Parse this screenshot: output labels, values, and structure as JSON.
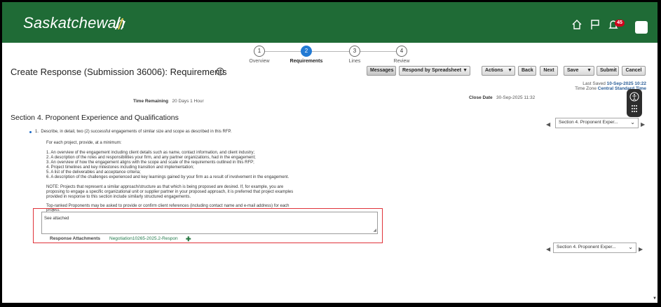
{
  "header": {
    "logo_text": "Saskatchewan",
    "notification_count": "45",
    "icons": [
      "home-icon",
      "flag-icon",
      "bell-icon",
      "user-avatar"
    ],
    "background": "#1f6b36"
  },
  "train": {
    "steps": [
      {
        "number": "1",
        "label": "Overview",
        "active": false
      },
      {
        "number": "2",
        "label": "Requirements",
        "active": true
      },
      {
        "number": "3",
        "label": "Lines",
        "active": false
      },
      {
        "number": "4",
        "label": "Review",
        "active": false
      }
    ]
  },
  "page": {
    "title": "Create Response (Submission 36006): Requirements"
  },
  "toolbar": {
    "messages": "Messages",
    "respond_by_spreadsheet": "Respond by Spreadsheet",
    "actions": "Actions",
    "back": "Back",
    "next": "Next",
    "save": "Save",
    "submit": "Submit",
    "cancel": "Cancel"
  },
  "status": {
    "last_saved_label": "Last Saved",
    "last_saved_value": "10-Sep-2025 10:22",
    "time_zone_label": "Time Zone",
    "time_zone_value": "Central Standard Time",
    "time_remaining_label": "Time Remaining",
    "time_remaining_value": "20 Days 1 Hour",
    "close_date_label": "Close Date",
    "close_date_value": "30-Sep-2025 11:32"
  },
  "section": {
    "title": "Section 4. Proponent Experience and Qualifications",
    "selector_top": "Section 4. Proponent Exper...",
    "selector_bottom": "Section 4. Proponent Exper..."
  },
  "question": {
    "number": "1.",
    "text": "Describe, in detail, two (2) successful engagements of similar size and scope as described in this RFP.",
    "intro": "For each project, provide, at a minimum:",
    "items": [
      "1. An overview of the engagement including client details such as name, contact information, and client industry;",
      "2. A description of the roles and responsibilities your firm, and any partner organizations, had in the engagement;",
      "3. An overview of how the engagement aligns with the scope and scale of the requirements outlined in this RFP;",
      "4. Project timelines and key milestones including transition and implementation;",
      "5. A list of the deliverables and acceptance criteria;",
      "6. A description of the challenges experienced and key learnings gained by your firm as a result of involvement in the engagement."
    ],
    "note_lines": [
      "NOTE:  Projects that represent a similar approach/structure as that which is being proposed are desired. If, for example, you are",
      "proposing to engage a specific organizational unit or supplier partner in your proposed approach, it is preferred that project examples",
      "provided in response to this section include similarly structured engagements."
    ],
    "references_lines": [
      "Top-ranked Proponents may be asked to provide or confirm client references (including contact name and e-mail address) for each",
      "project."
    ]
  },
  "response": {
    "value": "See attached",
    "attachments_label": "Response Attachments",
    "attachment_name": "Negotiation10265-2025.2-Respon"
  }
}
